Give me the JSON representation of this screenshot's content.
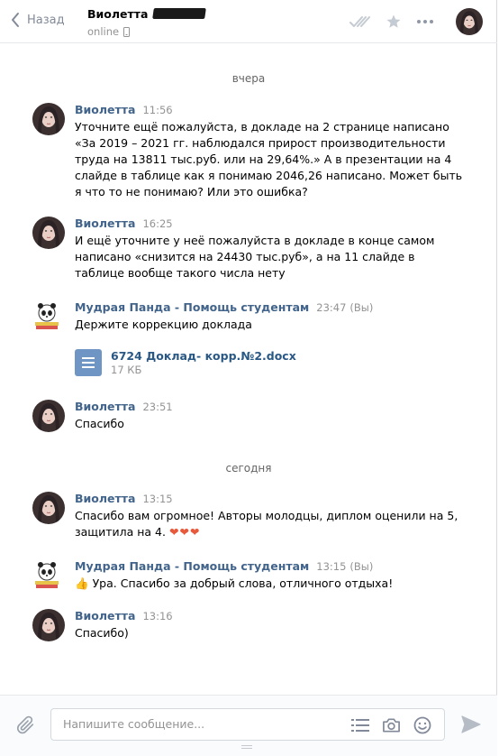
{
  "header": {
    "back_label": "Назад",
    "peer_name": "Виолетта",
    "peer_status": "online"
  },
  "messages": [
    {
      "type": "day",
      "label": "вчера"
    },
    {
      "author": "Виолетта",
      "time": "11:56",
      "text": "Уточните ещё пожалуйста, в докладе на 2 странице написано «За 2019 – 2021 гг. наблюдался прирост производительности труда на 13811 тыс.руб. или на 29,64%.» А в презентации на 4 слайде в таблице как я понимаю 2046,26 написано. Может быть я что то не понимаю? Или это ошибка?"
    },
    {
      "author": "Виолетта",
      "time": "16:25",
      "text": "И ещё уточните у неё пожалуйста в докладе в конце самом написано «снизится на 24430 тыс.руб», а на 11 слайде в таблице вообще такого числа нету"
    },
    {
      "author": "Мудрая Панда - Помощь студентам",
      "time": "23:47",
      "tag": "(Вы)",
      "text": "Держите коррекцию доклада",
      "attachment": {
        "name": "6724 Доклад- корр.№2.docx",
        "size": "17 КБ"
      }
    },
    {
      "author": "Виолетта",
      "time": "23:51",
      "text": "Спасибо"
    },
    {
      "type": "day",
      "label": "сегодня"
    },
    {
      "author": "Виолетта",
      "time": "13:15",
      "text": "Спасибо вам огромное! Авторы молодцы, диплом оценили на 5, защитила на 4.",
      "emoji": "❤❤❤"
    },
    {
      "author": "Мудрая Панда - Помощь студентам",
      "time": "13:15",
      "tag": "(Вы)",
      "text": "Ура. Спасибо за добрый слова, отличного отдыха!",
      "emoji_prefix": "👍"
    },
    {
      "author": "Виолетта",
      "time": "13:16",
      "text": "Спасибо)"
    }
  ],
  "composer": {
    "placeholder": "Напишите сообщение..."
  },
  "colors": {
    "link": "#42648b",
    "meta": "#939393",
    "doc_icon": "#6f95c4",
    "heart": "#e8593c"
  },
  "icons": [
    "chevron-left-icon",
    "phone-icon",
    "double-check-icon",
    "star-icon",
    "more-icon",
    "paperclip-icon",
    "list-icon",
    "camera-icon",
    "emoji-icon",
    "send-icon",
    "document-icon"
  ]
}
